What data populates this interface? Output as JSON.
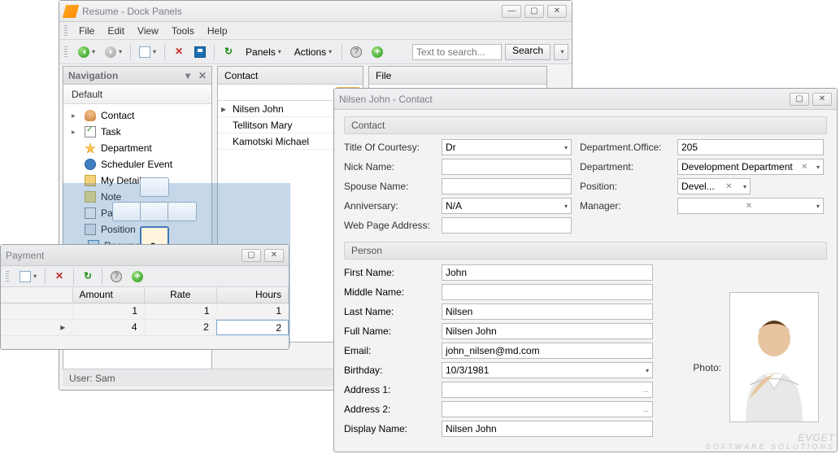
{
  "main": {
    "title": "Resume - Dock Panels",
    "menu": [
      "File",
      "Edit",
      "View",
      "Tools",
      "Help"
    ],
    "toolbar": {
      "panels": "Panels",
      "actions": "Actions",
      "search_placeholder": "Text to search...",
      "search_btn": "Search"
    },
    "nav": {
      "title": "Navigation",
      "group": "Default",
      "items": [
        {
          "label": "Contact",
          "exp": "▸"
        },
        {
          "label": "Task",
          "exp": "▸"
        },
        {
          "label": "Department",
          "exp": ""
        },
        {
          "label": "Scheduler Event",
          "exp": ""
        },
        {
          "label": "My Details",
          "exp": ""
        },
        {
          "label": "Note",
          "exp": ""
        },
        {
          "label": "Payment",
          "exp": ""
        },
        {
          "label": "Position",
          "exp": ""
        },
        {
          "label": "Resume",
          "exp": ""
        }
      ]
    },
    "contact_list": {
      "header": "Contact",
      "rows": [
        "Nilsen John",
        "Tellitson Mary",
        "Kamotski Michael"
      ]
    },
    "file_tab": "File",
    "status": "User: Sam"
  },
  "payment": {
    "title": "Payment",
    "cols": [
      "Amount",
      "Rate",
      "Hours"
    ],
    "rows": [
      [
        "1",
        "1",
        "1"
      ],
      [
        "4",
        "2",
        "2"
      ]
    ]
  },
  "detail": {
    "title": "Nilsen John - Contact",
    "group1": "Contact",
    "fields1": {
      "title_courtesy_lbl": "Title Of Courtesy:",
      "title_courtesy": "Dr",
      "dept_office_lbl": "Department.Office:",
      "dept_office": "205",
      "nick_lbl": "Nick Name:",
      "nick": "",
      "dept_lbl": "Department:",
      "dept": "Development Department",
      "spouse_lbl": "Spouse Name:",
      "spouse": "",
      "position_lbl": "Position:",
      "position": "Devel...",
      "anniv_lbl": "Anniversary:",
      "anniv": "N/A",
      "manager_lbl": "Manager:",
      "manager": "",
      "web_lbl": "Web Page Address:",
      "web": ""
    },
    "group2": "Person",
    "fields2": {
      "first_lbl": "First Name:",
      "first": "John",
      "middle_lbl": "Middle Name:",
      "middle": "",
      "last_lbl": "Last Name:",
      "last": "Nilsen",
      "full_lbl": "Full Name:",
      "full": "Nilsen John",
      "email_lbl": "Email:",
      "email": "john_nilsen@md.com",
      "birth_lbl": "Birthday:",
      "birth": "10/3/1981",
      "addr1_lbl": "Address 1:",
      "addr1": "",
      "addr2_lbl": "Address 2:",
      "addr2": "",
      "display_lbl": "Display Name:",
      "display": "Nilsen John",
      "photo_lbl": "Photo:"
    }
  },
  "watermark": {
    "brand": "EVGET",
    "tag": "SOFTWARE SOLUTIONS"
  }
}
